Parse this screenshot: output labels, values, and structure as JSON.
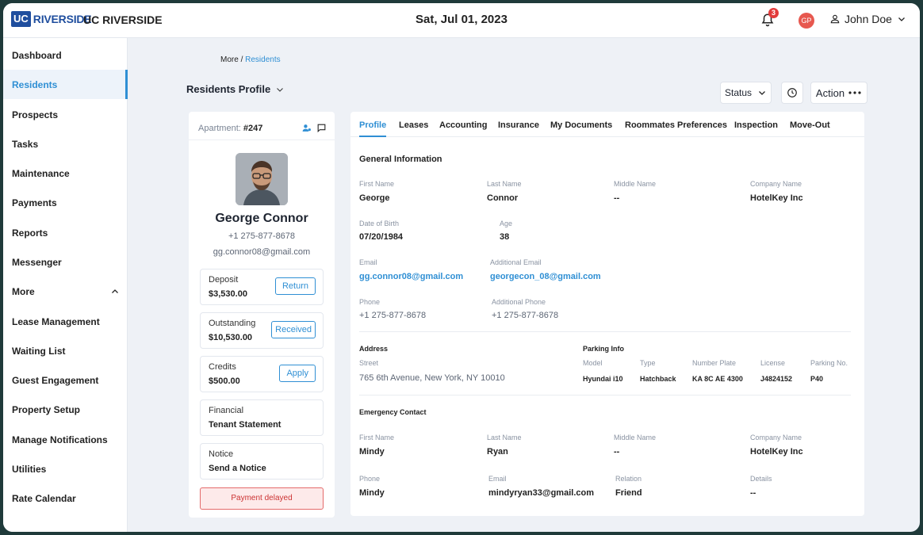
{
  "header": {
    "logo_mark": "UC",
    "logo_word": "RIVERSIDE",
    "brand": "UC RIVERSIDE",
    "date": "Sat, Jul 01, 2023",
    "notification_count": "3",
    "avatar_initials": "GP",
    "user_name": "John Doe"
  },
  "sidebar": {
    "items": [
      {
        "label": "Dashboard"
      },
      {
        "label": "Residents",
        "active": true
      },
      {
        "label": "Prospects"
      },
      {
        "label": "Tasks"
      },
      {
        "label": "Maintenance"
      },
      {
        "label": "Payments"
      },
      {
        "label": "Reports"
      },
      {
        "label": "Messenger"
      },
      {
        "label": "More",
        "expanded": true
      },
      {
        "label": "Lease Management"
      },
      {
        "label": "Waiting List"
      },
      {
        "label": "Guest Engagement"
      },
      {
        "label": "Property Setup"
      },
      {
        "label": "Manage Notifications"
      },
      {
        "label": "Utilities"
      },
      {
        "label": "Rate Calendar"
      }
    ]
  },
  "breadcrumb": {
    "parent": "More",
    "separator": " / ",
    "current": "Residents"
  },
  "page_title": "Residents Profile",
  "toolbar": {
    "status_label": "Status",
    "action_label": "Action"
  },
  "resident": {
    "apartment_label": "Apartment:",
    "apartment_number": "#247",
    "name": "George Connor",
    "phone": "+1 275-877-8678",
    "email": "gg.connor08@gmail.com",
    "deposit": {
      "label": "Deposit",
      "value": "$3,530.00",
      "button": "Return"
    },
    "outstanding": {
      "label": "Outstanding",
      "value": "$10,530.00",
      "button": "Received"
    },
    "credits": {
      "label": "Credits",
      "value": "$500.00",
      "button": "Apply"
    },
    "financial": {
      "label": "Financial",
      "value": "Tenant Statement"
    },
    "notice": {
      "label": "Notice",
      "value": "Send a Notice"
    },
    "alert": "Payment delayed"
  },
  "tabs": [
    "Profile",
    "Leases",
    "Accounting",
    "Insurance",
    "My Documents",
    "Roommates Preferences",
    "Inspection",
    "Move-Out"
  ],
  "general": {
    "title": "General Information",
    "first_name_label": "First Name",
    "first_name": "George",
    "last_name_label": "Last Name",
    "last_name": "Connor",
    "middle_name_label": "Middle Name",
    "middle_name": "--",
    "company_label": "Company Name",
    "company": "HotelKey Inc",
    "dob_label": "Date of Birth",
    "dob": "07/20/1984",
    "age_label": "Age",
    "age": "38",
    "email_label": "Email",
    "email": "gg.connor08@gmail.com",
    "add_email_label": "Additional Email",
    "add_email": "georgecon_08@gmail.com",
    "phone_label": "Phone",
    "phone": "+1 275-877-8678",
    "add_phone_label": "Additional Phone",
    "add_phone": "+1 275-877-8678"
  },
  "address": {
    "title": "Address",
    "street_label": "Street",
    "street": "765 6th Avenue, New York, NY 10010"
  },
  "parking": {
    "title": "Parking Info",
    "model_label": "Model",
    "model": "Hyundai i10",
    "type_label": "Type",
    "type": "Hatchback",
    "plate_label": "Number Plate",
    "plate": "KA 8C AE 4300",
    "license_label": "License",
    "license": "J4824152",
    "parking_no_label": "Parking No.",
    "parking_no": "P40"
  },
  "emergency": {
    "title": "Emergency Contact",
    "first_name_label": "First Name",
    "first_name": "Mindy",
    "last_name_label": "Last Name",
    "last_name": "Ryan",
    "middle_name_label": "Middle Name",
    "middle_name": "--",
    "company_label": "Company Name",
    "company": "HotelKey Inc",
    "phone_label": "Phone",
    "phone": "Mindy",
    "email_label": "Email",
    "email": "mindyryan33@gmail.com",
    "relation_label": "Relation",
    "relation": "Friend",
    "details_label": "Details",
    "details": "--"
  },
  "colors": {
    "accent": "#2f8fd4",
    "brand": "#1f4e9e",
    "alert": "#c33333",
    "frame": "#1f3a3a"
  }
}
